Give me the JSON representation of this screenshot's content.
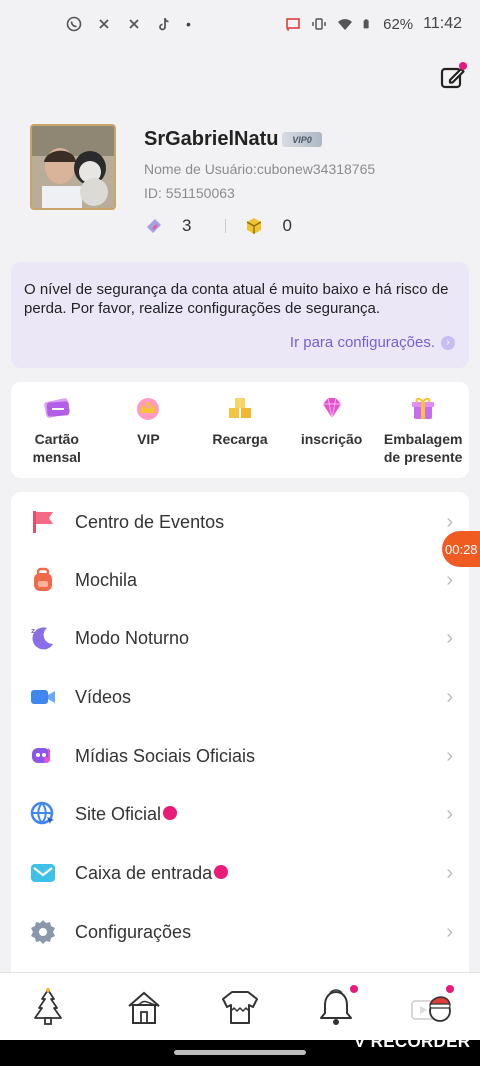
{
  "status_bar": {
    "battery": "62%",
    "time": "11:42"
  },
  "profile": {
    "name": "SrGabrielNatu",
    "vip_badge": "VIP0",
    "username_line": "Nome de Usuário:cubonew34318765",
    "id_line": "ID: 551150063",
    "stat_tickets": "3",
    "stat_cubes": "0"
  },
  "alert": {
    "message": "O nível de segurança da conta atual é muito baixo e há risco de perda. Por favor, realize configurações de segurança.",
    "link": "Ir para configurações."
  },
  "shortcuts": [
    {
      "label": "Cartão mensal",
      "icon": "card-icon"
    },
    {
      "label": "VIP",
      "icon": "crown-icon"
    },
    {
      "label": "Recarga",
      "icon": "cubes-icon"
    },
    {
      "label": "inscrição",
      "icon": "gem-icon"
    },
    {
      "label": "Embalagem de presente",
      "icon": "gift-icon"
    }
  ],
  "menu": [
    {
      "label": "Centro de Eventos",
      "icon": "flag-icon"
    },
    {
      "label": "Mochila",
      "icon": "backpack-icon"
    },
    {
      "label": "Modo Noturno",
      "icon": "moon-icon"
    },
    {
      "label": "Vídeos",
      "icon": "video-camera-icon"
    },
    {
      "label": "Mídias Sociais Oficiais",
      "icon": "social-media-icon"
    },
    {
      "label": "Site Oficial",
      "icon": "globe-icon"
    },
    {
      "label": "Caixa de entrada",
      "icon": "mail-icon"
    },
    {
      "label": "Configurações",
      "icon": "gear-icon"
    }
  ],
  "timer": "00:28",
  "watermark": "V RECORDER",
  "colors": {
    "accent": "#7a5fd0",
    "alert_bg": "#ebe7f7",
    "badge_red": "#ea1a78",
    "timer_orange": "#f05b22"
  }
}
